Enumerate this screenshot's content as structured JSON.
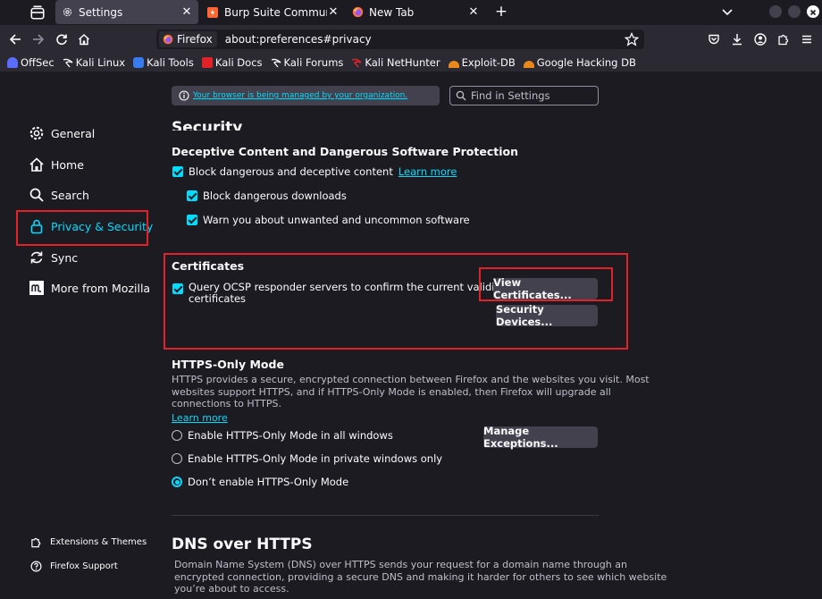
{
  "tabs": [
    {
      "title": "Settings",
      "active": true
    },
    {
      "title": "Burp Suite Community Ed",
      "active": false
    },
    {
      "title": "New Tab",
      "active": false
    }
  ],
  "urlbar": {
    "identity": "Firefox",
    "url": "about:preferences#privacy"
  },
  "bookmarks": [
    "OffSec",
    "Kali Linux",
    "Kali Tools",
    "Kali Docs",
    "Kali Forums",
    "Kali NetHunter",
    "Exploit-DB",
    "Google Hacking DB"
  ],
  "policy": {
    "text": "Your browser is being managed by your organization."
  },
  "find": {
    "placeholder": "Find in Settings"
  },
  "sidebar": {
    "items": [
      {
        "label": "General",
        "icon": "gear-icon"
      },
      {
        "label": "Home",
        "icon": "home-icon"
      },
      {
        "label": "Search",
        "icon": "search-icon"
      },
      {
        "label": "Privacy & Security",
        "icon": "lock-icon",
        "selected": true
      },
      {
        "label": "Sync",
        "icon": "sync-icon"
      },
      {
        "label": "More from Mozilla",
        "icon": "mozilla-icon"
      }
    ],
    "footer": [
      {
        "label": "Extensions & Themes",
        "icon": "puzzle-icon"
      },
      {
        "label": "Firefox Support",
        "icon": "help-icon"
      }
    ]
  },
  "security": {
    "heading": "Security",
    "deceptive_heading": "Deceptive Content and Dangerous Software Protection",
    "block_deceptive": "Block dangerous and deceptive content",
    "learn_more": "Learn more",
    "block_downloads": "Block dangerous downloads",
    "warn_unwanted": "Warn you about unwanted and uncommon software"
  },
  "certificates": {
    "heading": "Certificates",
    "ocsp_line1": "Query OCSP responder servers to confirm the current validity of",
    "ocsp_line2": "certificates",
    "view_button": "View Certificates...",
    "devices_button": "Security Devices..."
  },
  "https_only": {
    "heading": "HTTPS-Only Mode",
    "desc_line1": "HTTPS provides a secure, encrypted connection between Firefox and the websites you visit. Most",
    "desc_line2": "websites support HTTPS, and if HTTPS-Only Mode is enabled, then Firefox will upgrade all",
    "desc_line3": "connections to HTTPS.",
    "learn_more": "Learn more",
    "manage_button": "Manage Exceptions...",
    "options": [
      {
        "label": "Enable HTTPS-Only Mode in all windows",
        "selected": false
      },
      {
        "label": "Enable HTTPS-Only Mode in private windows only",
        "selected": false
      },
      {
        "label": "Don’t enable HTTPS-Only Mode",
        "selected": true
      }
    ]
  },
  "dns": {
    "heading": "DNS over HTTPS",
    "desc_line1": "Domain Name System (DNS) over HTTPS sends your request for a domain name through an",
    "desc_line2": "encrypted connection, providing a secure DNS and making it harder for others to see which website",
    "desc_line3": "you’re about to access."
  },
  "colors": {
    "accent": "#00ddff",
    "highlight": "#e22128",
    "background": "#1c1b22",
    "toolbar": "#2b2a33"
  }
}
